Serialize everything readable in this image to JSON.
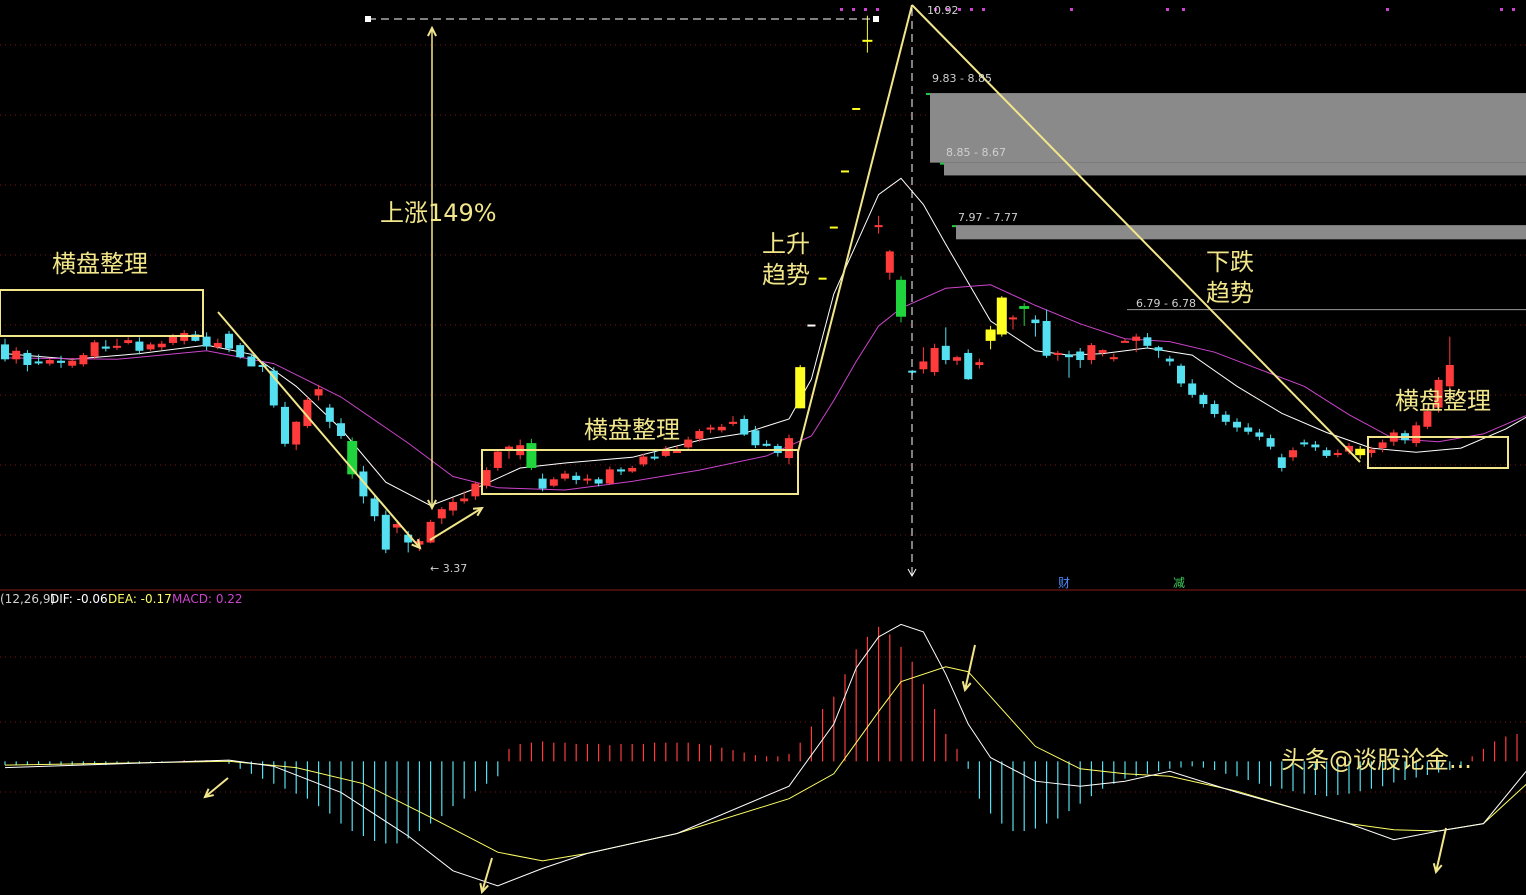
{
  "chart_data": {
    "type": "candlestick",
    "grid": true,
    "price_panel": {
      "ylim": [
        3.0,
        11.0
      ],
      "peak_label": "10.92",
      "low_label": "← 3.37",
      "zones": [
        {
          "label": "9.83 - 8.85",
          "top": 9.83,
          "bottom": 8.85
        },
        {
          "label": "8.85 - 8.67",
          "top": 8.85,
          "bottom": 8.67
        },
        {
          "label": "7.97 - 7.77",
          "top": 7.97,
          "bottom": 7.77
        }
      ],
      "resistance": {
        "label": "6.79 - 6.78",
        "value": 6.78
      },
      "candles": [
        [
          6.29,
          6.08,
          6.37,
          6.05
        ],
        [
          6.08,
          6.2,
          6.25,
          6.02
        ],
        [
          6.17,
          6.0,
          6.21,
          5.91
        ],
        [
          6.05,
          6.04,
          6.15,
          6.0
        ],
        [
          6.02,
          6.07,
          6.1,
          5.99
        ],
        [
          6.06,
          6.03,
          6.13,
          5.96
        ],
        [
          5.99,
          6.06,
          6.1,
          5.96
        ],
        [
          6.01,
          6.14,
          6.17,
          5.98
        ],
        [
          6.12,
          6.32,
          6.35,
          6.08
        ],
        [
          6.26,
          6.23,
          6.35,
          6.19
        ],
        [
          6.26,
          6.27,
          6.37,
          6.21
        ],
        [
          6.31,
          6.35,
          6.39,
          6.29
        ],
        [
          6.33,
          6.2,
          6.39,
          6.15
        ],
        [
          6.22,
          6.29,
          6.32,
          6.2
        ],
        [
          6.25,
          6.3,
          6.34,
          6.21
        ],
        [
          6.31,
          6.4,
          6.44,
          6.28
        ],
        [
          6.34,
          6.45,
          6.49,
          6.29
        ],
        [
          6.43,
          6.34,
          6.48,
          6.33
        ],
        [
          6.4,
          6.26,
          6.46,
          6.21
        ],
        [
          6.25,
          6.31,
          6.37,
          6.22
        ],
        [
          6.44,
          6.23,
          6.48,
          6.18
        ],
        [
          6.28,
          6.11,
          6.31,
          6.09
        ],
        [
          6.12,
          5.98,
          6.16,
          5.98
        ],
        [
          6.0,
          5.98,
          6.05,
          5.9
        ],
        [
          5.92,
          5.43,
          5.97,
          5.4
        ],
        [
          5.41,
          4.89,
          5.48,
          4.85
        ],
        [
          4.88,
          5.2,
          5.21,
          4.8
        ],
        [
          5.14,
          5.51,
          5.55,
          5.11
        ],
        [
          5.57,
          5.66,
          5.72,
          5.5
        ],
        [
          5.4,
          5.2,
          5.45,
          5.11
        ],
        [
          5.18,
          5.0,
          5.25,
          4.96
        ],
        [
          4.93,
          4.46,
          4.98,
          4.4
        ],
        [
          4.5,
          4.15,
          4.58,
          4.05
        ],
        [
          4.12,
          3.87,
          4.16,
          3.8
        ],
        [
          3.89,
          3.4,
          3.95,
          3.35
        ],
        [
          3.71,
          3.76,
          3.79,
          3.63
        ],
        [
          3.61,
          3.5,
          3.66,
          3.36
        ],
        [
          3.47,
          3.52,
          3.56,
          3.38
        ],
        [
          3.5,
          3.79,
          3.82,
          3.49
        ],
        [
          3.84,
          3.97,
          4.0,
          3.76
        ],
        [
          3.95,
          4.07,
          4.13,
          3.88
        ],
        [
          4.08,
          4.12,
          4.22,
          4.05
        ],
        [
          4.15,
          4.33,
          4.36,
          4.1
        ],
        [
          4.3,
          4.52,
          4.56,
          4.26
        ],
        [
          4.55,
          4.78,
          4.81,
          4.51
        ],
        [
          4.8,
          4.85,
          4.87,
          4.68
        ],
        [
          4.73,
          4.87,
          4.95,
          4.67
        ],
        [
          4.9,
          4.55,
          4.96,
          4.52
        ],
        [
          4.4,
          4.26,
          4.47,
          4.22
        ],
        [
          4.3,
          4.39,
          4.42,
          4.28
        ],
        [
          4.4,
          4.47,
          4.51,
          4.37
        ],
        [
          4.44,
          4.38,
          4.49,
          4.32
        ],
        [
          4.39,
          4.4,
          4.46,
          4.32
        ],
        [
          4.39,
          4.33,
          4.42,
          4.29
        ],
        [
          4.33,
          4.53,
          4.57,
          4.31
        ],
        [
          4.53,
          4.5,
          4.56,
          4.45
        ],
        [
          4.5,
          4.55,
          4.58,
          4.48
        ],
        [
          4.6,
          4.71,
          4.75,
          4.57
        ],
        [
          4.71,
          4.7,
          4.78,
          4.66
        ],
        [
          4.72,
          4.82,
          4.86,
          4.7
        ],
        [
          4.76,
          4.81,
          4.86,
          4.77
        ],
        [
          4.84,
          4.95,
          4.99,
          4.82
        ],
        [
          4.96,
          5.07,
          5.1,
          4.92
        ],
        [
          5.09,
          5.12,
          5.16,
          5.04
        ],
        [
          5.08,
          5.13,
          5.17,
          5.05
        ],
        [
          5.17,
          5.2,
          5.28,
          5.14
        ],
        [
          5.24,
          5.02,
          5.29,
          5.0
        ],
        [
          5.08,
          4.87,
          5.14,
          4.83
        ],
        [
          4.89,
          4.88,
          4.94,
          4.85
        ],
        [
          4.86,
          4.76,
          4.89,
          4.71
        ],
        [
          4.69,
          4.97,
          5.02,
          4.6
        ],
        [
          5.39,
          5.97,
          6.0,
          5.39
        ],
        [
          6.57,
          6.57,
          6.57,
          6.57
        ],
        [
          7.23,
          7.23,
          7.23,
          7.23
        ],
        [
          7.95,
          7.95,
          7.95,
          7.95
        ],
        [
          8.74,
          8.74,
          8.74,
          8.74
        ],
        [
          9.62,
          9.62,
          9.62,
          9.62
        ],
        [
          10.58,
          10.58,
          10.92,
          10.4
        ],
        [
          7.97,
          7.97,
          8.1,
          7.85
        ],
        [
          7.3,
          7.6,
          7.62,
          7.2
        ],
        [
          7.2,
          6.68,
          7.25,
          6.6
        ],
        [
          5.92,
          5.91,
          5.93,
          5.86
        ],
        [
          5.94,
          6.05,
          6.25,
          5.88
        ],
        [
          5.9,
          6.24,
          6.3,
          5.85
        ],
        [
          6.27,
          6.07,
          6.53,
          6.01
        ],
        [
          6.06,
          6.11,
          6.13,
          6.0
        ],
        [
          6.17,
          5.8,
          6.22,
          5.79
        ],
        [
          6.0,
          6.04,
          6.09,
          5.95
        ],
        [
          6.34,
          6.5,
          6.55,
          6.22
        ],
        [
          6.95,
          6.43,
          6.97,
          6.4
        ],
        [
          6.67,
          6.67,
          6.7,
          6.5
        ],
        [
          6.79,
          6.83,
          6.87,
          6.55
        ],
        [
          6.64,
          6.59,
          6.7,
          6.4
        ],
        [
          6.62,
          6.13,
          6.78,
          6.1
        ],
        [
          6.17,
          6.17,
          6.2,
          6.06
        ],
        [
          6.15,
          6.11,
          6.2,
          5.82
        ],
        [
          6.19,
          6.07,
          6.24,
          5.96
        ],
        [
          6.07,
          6.28,
          6.31,
          6.01
        ],
        [
          6.17,
          6.21,
          6.22,
          6.12
        ],
        [
          6.1,
          6.11,
          6.16,
          6.05
        ],
        [
          6.33,
          6.34,
          6.37,
          6.32
        ],
        [
          6.34,
          6.4,
          6.44,
          6.18
        ],
        [
          6.39,
          6.27,
          6.45,
          6.23
        ],
        [
          6.25,
          6.2,
          6.27,
          6.1
        ],
        [
          6.09,
          6.05,
          6.13,
          5.99
        ],
        [
          5.99,
          5.74,
          6.02,
          5.69
        ],
        [
          5.74,
          5.58,
          5.8,
          5.54
        ],
        [
          5.58,
          5.45,
          5.61,
          5.4
        ],
        [
          5.45,
          5.31,
          5.5,
          5.26
        ],
        [
          5.3,
          5.2,
          5.35,
          5.15
        ],
        [
          5.2,
          5.12,
          5.25,
          5.06
        ],
        [
          5.12,
          5.06,
          5.18,
          5.02
        ],
        [
          5.05,
          4.99,
          5.1,
          4.94
        ],
        [
          4.97,
          4.85,
          5.02,
          4.81
        ],
        [
          4.7,
          4.55,
          4.75,
          4.5
        ],
        [
          4.7,
          4.8,
          4.84,
          4.65
        ],
        [
          4.91,
          4.9,
          4.95,
          4.85
        ],
        [
          4.88,
          4.84,
          4.93,
          4.79
        ],
        [
          4.8,
          4.72,
          4.84,
          4.69
        ],
        [
          4.74,
          4.76,
          4.81,
          4.7
        ],
        [
          4.78,
          4.86,
          4.9,
          4.74
        ],
        [
          4.82,
          4.73,
          4.86,
          4.68
        ],
        [
          4.76,
          4.81,
          4.85,
          4.7
        ],
        [
          4.83,
          4.91,
          4.95,
          4.77
        ],
        [
          4.92,
          5.05,
          5.09,
          4.86
        ],
        [
          5.04,
          4.94,
          5.08,
          4.89
        ],
        [
          4.9,
          5.15,
          5.2,
          4.85
        ],
        [
          5.13,
          5.35,
          5.4,
          5.1
        ],
        [
          5.4,
          5.79,
          5.83,
          5.33
        ],
        [
          5.7,
          6.0,
          6.4,
          5.55
        ]
      ],
      "series": [
        {
          "color": "#ffffff",
          "x": [
            0,
            6,
            12,
            18,
            22,
            26,
            30,
            34,
            38,
            42,
            46,
            50,
            56,
            62,
            66,
            70,
            72,
            74,
            76,
            78,
            80,
            82,
            84,
            88,
            92,
            95,
            98,
            102,
            106,
            110,
            114,
            118,
            122,
            126,
            130,
            134,
            136
          ],
          "values": [
            6.16,
            6.08,
            6.16,
            6.28,
            6.15,
            5.7,
            5.1,
            4.35,
            4.02,
            4.26,
            4.55,
            4.62,
            4.7,
            4.94,
            5.04,
            5.24,
            5.8,
            7.0,
            7.7,
            8.4,
            8.63,
            8.26,
            7.7,
            6.62,
            6.2,
            6.14,
            6.16,
            6.24,
            6.14,
            5.7,
            5.32,
            5.05,
            4.83,
            4.77,
            4.83,
            5.1,
            5.28
          ]
        },
        {
          "color": "#cc44cc",
          "x": [
            0,
            10,
            18,
            24,
            30,
            36,
            40,
            44,
            50,
            56,
            62,
            68,
            72,
            74,
            76,
            78,
            80,
            84,
            88,
            92,
            96,
            100,
            104,
            108,
            112,
            116,
            120,
            124,
            128,
            132,
            136
          ],
          "values": [
            6.1,
            6.08,
            6.2,
            6.02,
            5.55,
            4.9,
            4.43,
            4.27,
            4.24,
            4.36,
            4.52,
            4.72,
            5.0,
            5.5,
            6.05,
            6.55,
            6.8,
            7.08,
            7.13,
            6.84,
            6.58,
            6.37,
            6.33,
            6.18,
            5.94,
            5.7,
            5.3,
            4.96,
            4.92,
            5.03,
            5.3
          ]
        }
      ],
      "event_labels": [
        "财",
        "减"
      ]
    },
    "macd_panel": {
      "header": {
        "name": "(12,26,9)",
        "dif": "DIF: -0.06",
        "dea": "DEA: -0.17",
        "macd": "MACD: 0.22"
      },
      "ylim": [
        -1.05,
        1.2
      ],
      "dif": {
        "x": [
          0,
          20,
          24,
          30,
          36,
          40,
          44,
          48,
          52,
          60,
          70,
          74,
          76,
          78,
          80,
          82,
          84,
          86,
          88,
          92,
          96,
          100,
          104,
          110,
          116,
          120,
          124,
          128,
          132,
          136
        ],
        "values": [
          -0.05,
          0.01,
          -0.04,
          -0.25,
          -0.6,
          -0.88,
          -1.0,
          -0.86,
          -0.74,
          -0.58,
          -0.2,
          0.3,
          0.75,
          1.0,
          1.1,
          1.04,
          0.7,
          0.3,
          0.03,
          -0.16,
          -0.2,
          -0.16,
          -0.08,
          -0.25,
          -0.4,
          -0.5,
          -0.63,
          -0.56,
          -0.5,
          -0.06
        ]
      },
      "dea": {
        "x": [
          0,
          20,
          26,
          32,
          38,
          44,
          48,
          52,
          60,
          70,
          74,
          76,
          78,
          80,
          84,
          86,
          88,
          92,
          96,
          100,
          104,
          110,
          116,
          120,
          124,
          128,
          132,
          136
        ],
        "values": [
          -0.03,
          0.0,
          -0.05,
          -0.18,
          -0.45,
          -0.73,
          -0.8,
          -0.74,
          -0.58,
          -0.3,
          -0.1,
          0.15,
          0.4,
          0.64,
          0.76,
          0.72,
          0.52,
          0.12,
          -0.06,
          -0.1,
          -0.12,
          -0.24,
          -0.4,
          -0.5,
          -0.55,
          -0.56,
          -0.5,
          -0.17
        ]
      },
      "bars": [
        -0.03,
        -0.03,
        -0.03,
        -0.03,
        -0.03,
        -0.03,
        -0.03,
        -0.03,
        -0.03,
        -0.03,
        -0.02,
        -0.02,
        -0.02,
        -0.01,
        -0.01,
        0.0,
        0.01,
        0.01,
        0.01,
        0.01,
        -0.02,
        -0.06,
        -0.1,
        -0.14,
        -0.18,
        -0.22,
        -0.26,
        -0.3,
        -0.36,
        -0.42,
        -0.5,
        -0.56,
        -0.6,
        -0.64,
        -0.66,
        -0.66,
        -0.62,
        -0.56,
        -0.5,
        -0.44,
        -0.36,
        -0.3,
        -0.24,
        -0.18,
        -0.12,
        0.1,
        0.14,
        0.15,
        0.16,
        0.15,
        0.15,
        0.14,
        0.14,
        0.14,
        0.13,
        0.14,
        0.14,
        0.14,
        0.15,
        0.15,
        0.15,
        0.15,
        0.14,
        0.13,
        0.11,
        0.09,
        0.07,
        0.05,
        0.04,
        0.04,
        0.06,
        0.15,
        0.28,
        0.42,
        0.52,
        0.7,
        0.9,
        1.0,
        1.08,
        1.02,
        0.92,
        0.8,
        0.62,
        0.42,
        0.22,
        0.1,
        -0.06,
        -0.3,
        -0.42,
        -0.5,
        -0.56,
        -0.56,
        -0.54,
        -0.5,
        -0.46,
        -0.4,
        -0.34,
        -0.28,
        -0.22,
        -0.18,
        -0.14,
        -0.12,
        -0.1,
        -0.08,
        -0.06,
        -0.05,
        -0.04,
        -0.05,
        -0.07,
        -0.1,
        -0.12,
        -0.15,
        -0.18,
        -0.2,
        -0.22,
        -0.24,
        -0.26,
        -0.27,
        -0.28,
        -0.27,
        -0.26,
        -0.24,
        -0.22,
        -0.2,
        -0.17,
        -0.15,
        -0.13,
        -0.11,
        -0.09,
        -0.07,
        -0.05,
        0.04,
        0.1,
        0.16,
        0.2,
        0.22,
        0.22
      ],
      "watermark": "头条@谈股论金..."
    },
    "annotations": {
      "consolidation_left": "横盘整理",
      "consolidation_mid": "横盘整理",
      "consolidation_right": "横盘整理",
      "rise_pct": "上涨149%",
      "uptrend_line1": "上升",
      "uptrend_line2": "趋势",
      "downtrend_line1": "下跌",
      "downtrend_line2": "趋势"
    },
    "colors": {
      "up": "#ff3b3b",
      "down": "#54e0f0",
      "highlight": "#ffff22",
      "big_down": "#1fd43c",
      "ma1": "#ffffff",
      "ma2": "#cc44cc",
      "annotation": "#f2e68a",
      "zone": "#8a8a8a",
      "grid": "#7a1414"
    }
  }
}
